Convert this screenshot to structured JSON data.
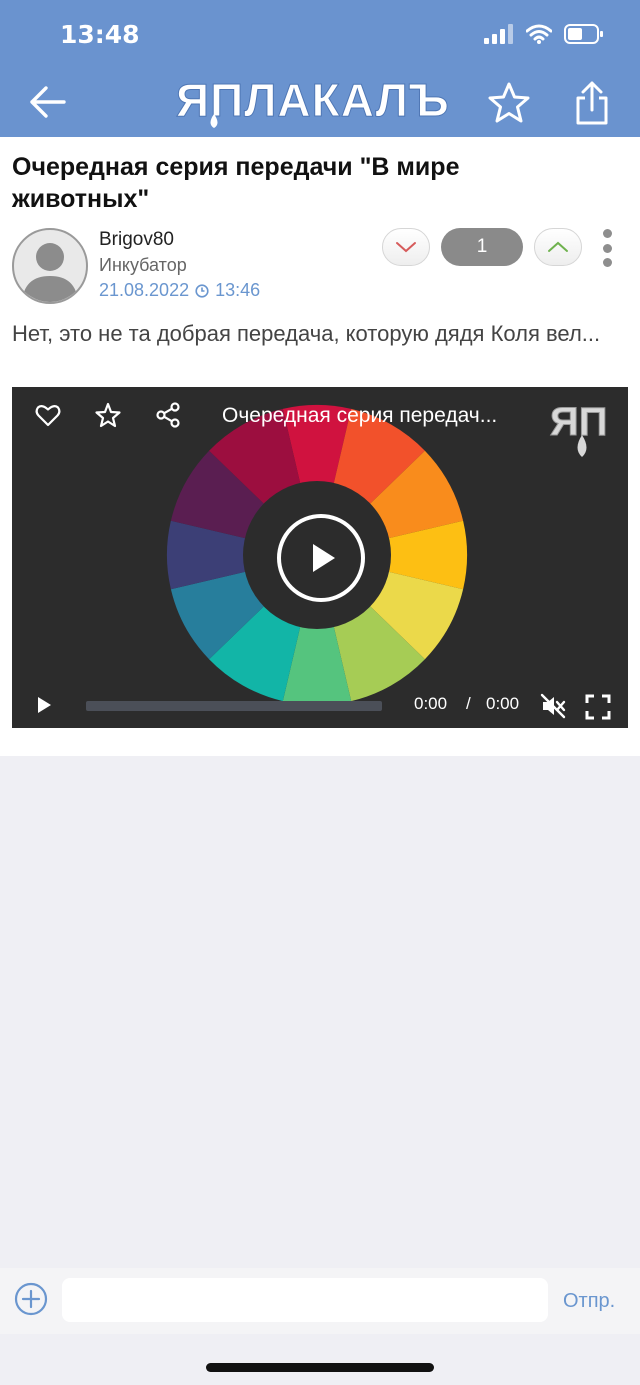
{
  "status_bar": {
    "time": "13:48",
    "icons": [
      "signal-icon",
      "wifi-icon",
      "battery-icon"
    ]
  },
  "nav": {
    "back_icon": "arrow-left-icon",
    "logo_text": "ЯПЛАКАЛЪ",
    "star_icon": "star-outline-icon",
    "share_icon": "share-icon"
  },
  "post": {
    "title": "Очередная серия передачи \"В мире животных\"",
    "author": "Brigov80",
    "rank": "Инкубатор",
    "date": "21.08.2022",
    "time": "13:46",
    "rating": "1",
    "excerpt": "Нет, это не та добрая передача, которую дядя Коля вел..."
  },
  "video": {
    "title": "Очередная серия передач...",
    "watermark": "ЯП",
    "current_time": "0:00",
    "separator": "/",
    "duration": "0:00",
    "progress": 0,
    "icons": [
      "heart-icon",
      "star-icon",
      "share-icon",
      "play-icon",
      "mute-icon",
      "fullscreen-icon"
    ]
  },
  "composer": {
    "placeholder": "",
    "send_label": "Отпр."
  },
  "colors": {
    "header": "#6a93cf",
    "link": "#6a96cf",
    "page_bg": "#efeff4",
    "video_bg": "#2c2c2c",
    "rating_pill": "#8a8a8a"
  }
}
